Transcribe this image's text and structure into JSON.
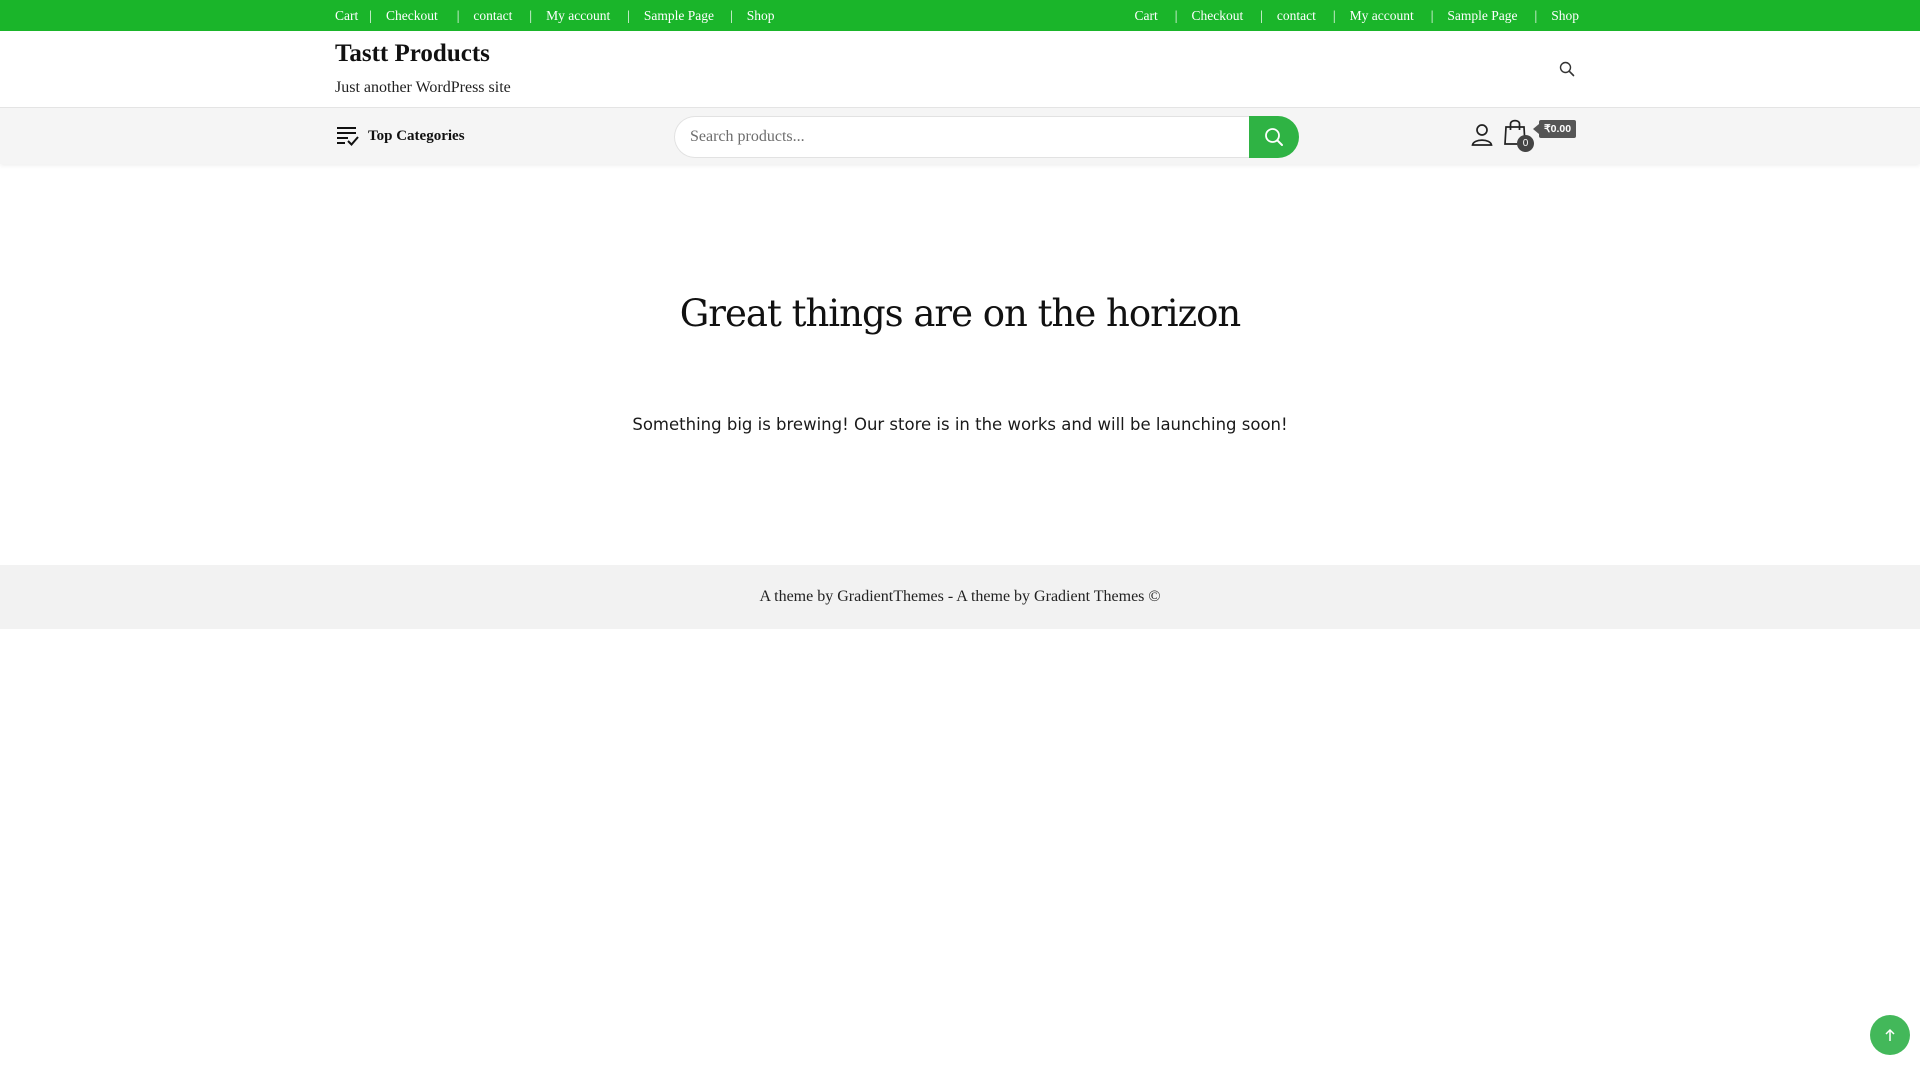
{
  "top_nav_left": {
    "items": [
      "Cart",
      "Checkout",
      "contact",
      "My account",
      "Sample Page",
      "Shop"
    ],
    "separator": "|"
  },
  "top_nav_right": {
    "items": [
      "Cart",
      "Checkout",
      "contact",
      "My account",
      "Sample Page",
      "Shop"
    ],
    "separator": "|"
  },
  "header": {
    "site_title": "Tastt Products",
    "tagline": "Just another WordPress site",
    "search_icon": "search-icon"
  },
  "catbar": {
    "categories_label": "Top Categories",
    "categories_icon": "list-check-icon",
    "search_placeholder": "Search products...",
    "search_button_icon": "search-icon",
    "account_icon": "user-icon",
    "cart_icon": "shopping-bag-icon",
    "cart_count": "0",
    "cart_total": "₹0.00"
  },
  "main": {
    "title": "Great things are on the horizon",
    "text": "Something big is brewing! Our store is in the works and will be launching soon!"
  },
  "footer": {
    "text": "A theme by GradientThemes - A theme by Gradient Themes ©"
  },
  "back_to_top_icon": "arrow-up-icon",
  "colors": {
    "topbar": "#1ab52a",
    "search_button": "#2fb344",
    "back_to_top": "#43b85a",
    "catbar_bg": "#f5f5f5",
    "footer_bg": "#f2f2f2"
  }
}
